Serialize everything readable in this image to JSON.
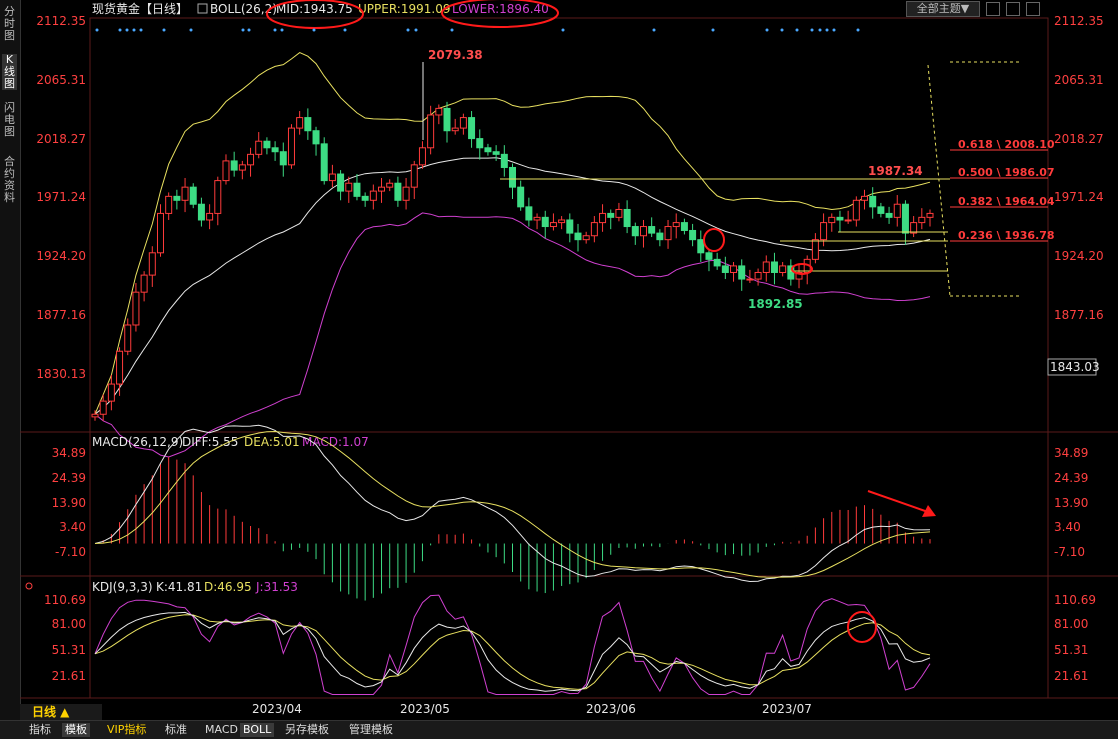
{
  "sidebar": {
    "tabs": [
      {
        "label": "分时图"
      },
      {
        "label": "K线图"
      },
      {
        "label": "闪电图"
      },
      {
        "label": "合约资料"
      }
    ]
  },
  "header": {
    "title": "现货黄金【日线】",
    "boll_label": "BOLL(26,2)",
    "mid_label": "MID:1943.75",
    "upper_label": "UPPER:1991.09",
    "lower_label": "LOWER:1896.40",
    "theme_button": "全部主题▼"
  },
  "price_axis": {
    "ticks": [
      "2112.35",
      "2065.31",
      "2018.27",
      "1971.24",
      "1924.20",
      "1877.16",
      "1830.13"
    ],
    "current_price": "1843.03"
  },
  "annotations": {
    "high": "2079.38",
    "low": "1892.85",
    "local_high": "1987.34",
    "fib_levels": [
      "0.618 \\ 2008.10",
      "0.500 \\ 1986.07",
      "0.382 \\ 1964.04",
      "0.236 \\ 1936.78"
    ]
  },
  "macd": {
    "title": "MACD(26,12,9)",
    "diff_label": "DIFF:5.55",
    "dea_label": "DEA:5.01",
    "macd_label": "MACD:1.07",
    "ticks": [
      "34.89",
      "24.39",
      "13.90",
      "3.40",
      "-7.10"
    ]
  },
  "kdj": {
    "title": "KDJ(9,3,3)",
    "k_label": "K:41.81",
    "d_label": "D:46.95",
    "j_label": "J:31.53",
    "ticks": [
      "110.69",
      "81.00",
      "51.31",
      "21.61"
    ]
  },
  "x_axis": {
    "labels": [
      "2023/04",
      "2023/05",
      "2023/06",
      "2023/07"
    ]
  },
  "period": "日线 ▲",
  "bottom_tabs": [
    {
      "label": "指标"
    },
    {
      "label": "模板"
    },
    {
      "label": "VIP指标"
    },
    {
      "label": "标准"
    },
    {
      "label": "MACD"
    },
    {
      "label": "BOLL"
    },
    {
      "label": "另存模板"
    },
    {
      "label": "管理模板"
    }
  ],
  "colors": {
    "up": "#ff3b3b",
    "down": "#3ddc84",
    "mid": "#e8e8e8",
    "upper": "#e8e060",
    "lower": "#d040d0",
    "annotation": "#ff2222",
    "axis_text": "#ff4040"
  },
  "chart_data": {
    "type": "candlestick",
    "instrument": "现货黄金",
    "period": "日线",
    "ylim": [
      1800,
      2112.35
    ],
    "x_labels": [
      "2023/04",
      "2023/05",
      "2023/06",
      "2023/07"
    ],
    "key_points": {
      "high": 2079.38,
      "low": 1892.85,
      "local_high": 1987.34
    },
    "fibonacci": [
      {
        "ratio": 0.618,
        "price": 2008.1
      },
      {
        "ratio": 0.5,
        "price": 1986.07
      },
      {
        "ratio": 0.382,
        "price": 1964.04
      },
      {
        "ratio": 0.236,
        "price": 1936.78
      }
    ],
    "boll": {
      "mid": 1943.75,
      "upper": 1991.09,
      "lower": 1896.4
    },
    "macd": {
      "diff": 5.55,
      "dea": 5.01,
      "macd": 1.07
    },
    "kdj": {
      "k": 41.81,
      "d": 46.95,
      "j": 31.53
    },
    "closes": [
      1812,
      1822,
      1835,
      1860,
      1880,
      1905,
      1918,
      1935,
      1965,
      1978,
      1975,
      1985,
      1972,
      1960,
      1965,
      1990,
      2005,
      1998,
      2002,
      2010,
      2020,
      2015,
      2012,
      2002,
      2030,
      2038,
      2028,
      2018,
      1990,
      1995,
      1982,
      1988,
      1978,
      1975,
      1982,
      1985,
      1988,
      1975,
      1985,
      2002,
      2015,
      2040,
      2045,
      2028,
      2030,
      2038,
      2022,
      2015,
      2012,
      2010,
      2000,
      1985,
      1970,
      1960,
      1962,
      1955,
      1958,
      1960,
      1950,
      1945,
      1948,
      1958,
      1965,
      1962,
      1968,
      1955,
      1948,
      1955,
      1950,
      1945,
      1955,
      1958,
      1952,
      1945,
      1935,
      1930,
      1925,
      1920,
      1925,
      1915,
      1915,
      1920,
      1928,
      1920,
      1925,
      1915,
      1920,
      1930,
      1945,
      1958,
      1962,
      1960,
      1960,
      1975,
      1978,
      1970,
      1965,
      1962,
      1972,
      1950,
      1958,
      1962,
      1965
    ]
  }
}
